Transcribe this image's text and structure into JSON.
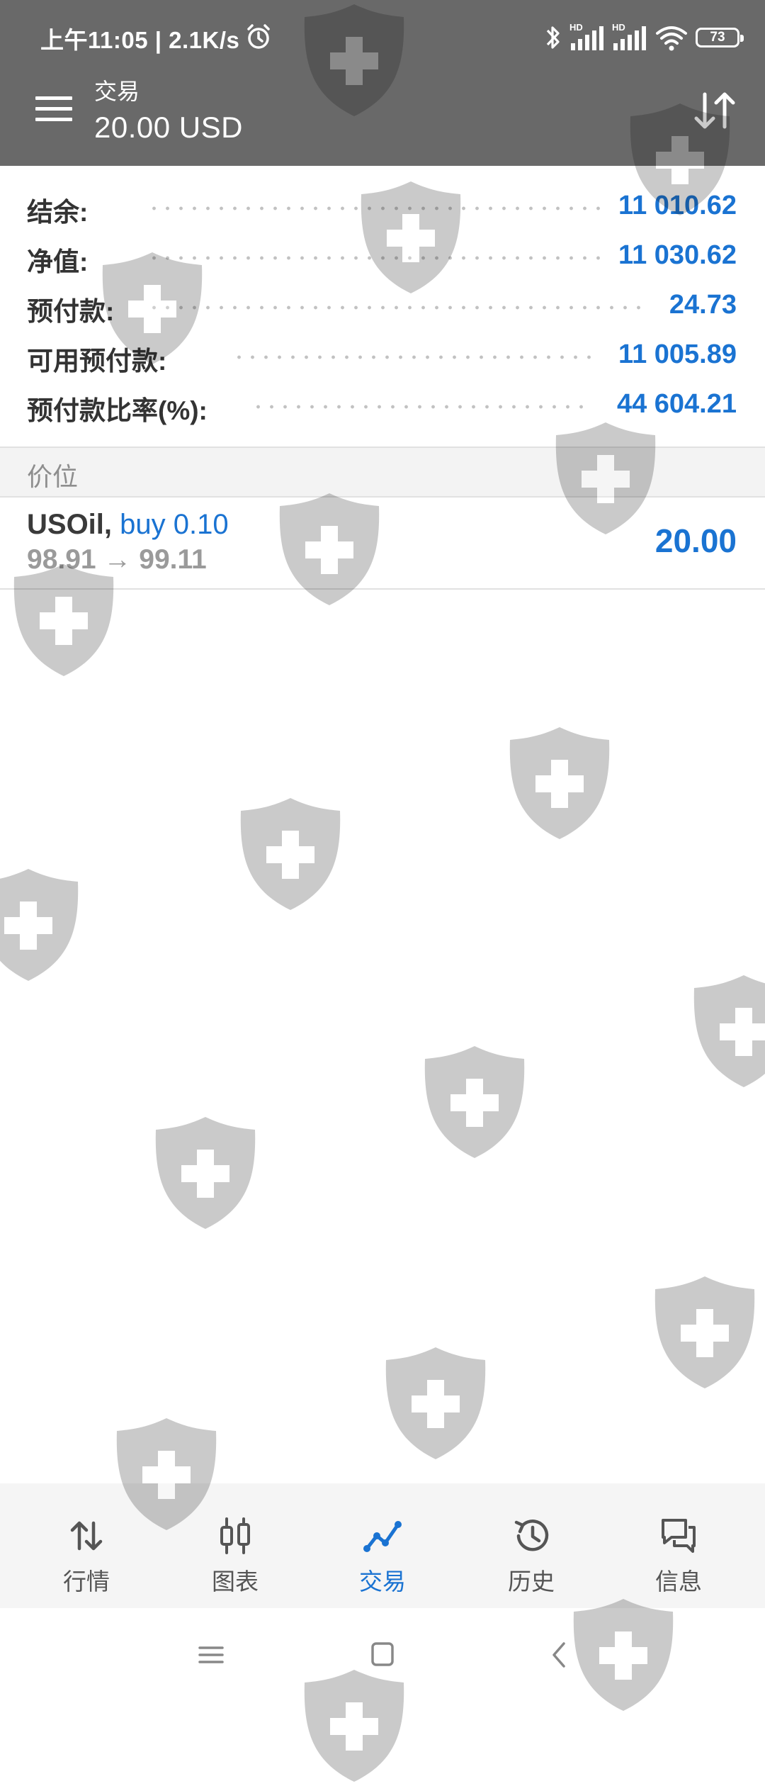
{
  "status_bar": {
    "time_speed": "上午11:05 | 2.1K/s",
    "network_label_1": "HD",
    "network_label_2": "HD",
    "battery_level": "73"
  },
  "header": {
    "subtitle": "交易",
    "title": "20.00 USD"
  },
  "summary": [
    {
      "label": "结余:",
      "value": "11 010.62"
    },
    {
      "label": "净值:",
      "value": "11 030.62"
    },
    {
      "label": "预付款:",
      "value": "24.73"
    },
    {
      "label": "可用预付款:",
      "value": "11 005.89"
    },
    {
      "label": "预付款比率(%):",
      "value": "44 604.21"
    }
  ],
  "positions_header": "价位",
  "positions": [
    {
      "symbol": "USOil,",
      "side": "buy 0.10",
      "prices": "98.91 → 99.11",
      "profit": "20.00"
    }
  ],
  "bottom_nav": [
    {
      "label": "行情",
      "icon": "arrows-updown-icon"
    },
    {
      "label": "图表",
      "icon": "candlestick-icon"
    },
    {
      "label": "交易",
      "icon": "trade-line-icon"
    },
    {
      "label": "历史",
      "icon": "history-icon"
    },
    {
      "label": "信息",
      "icon": "chat-icon"
    }
  ],
  "colors": {
    "header_bg": "#696969",
    "accent": "#1a73d2",
    "nav_bg": "#f5f5f5"
  }
}
